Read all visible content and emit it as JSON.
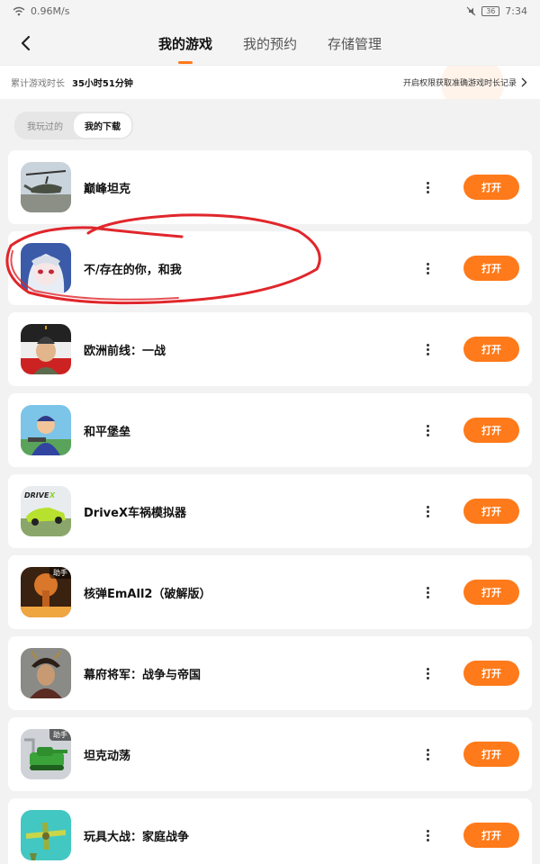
{
  "status": {
    "speed": "0.96M/s",
    "battery": "36",
    "time": "7:34"
  },
  "nav": {
    "tabs": [
      {
        "label": "我的游戏",
        "active": true
      },
      {
        "label": "我的预约",
        "active": false
      },
      {
        "label": "存储管理",
        "active": false
      }
    ]
  },
  "playtime": {
    "label": "累计游戏时长",
    "value": "35小时51分钟",
    "link": "开启权限获取准确游戏时长记录"
  },
  "filters": {
    "played": "我玩过的",
    "downloaded": "我的下载"
  },
  "open_label": "打开",
  "games": [
    {
      "name": "巅峰坦克",
      "icon": "helicopter-icon"
    },
    {
      "name": "不/存在的你，和我",
      "icon": "anime-girl-icon"
    },
    {
      "name": "欧洲前线：一战",
      "icon": "general-icon"
    },
    {
      "name": "和平堡垒",
      "icon": "soldier-icon"
    },
    {
      "name": "DriveX车祸模拟器",
      "icon": "car-icon"
    },
    {
      "name": "核弹EmAll2（破解版）",
      "icon": "nuke-icon",
      "badge": "助手"
    },
    {
      "name": "幕府将军：战争与帝国",
      "icon": "samurai-icon"
    },
    {
      "name": "坦克动荡",
      "icon": "tank-icon",
      "badge": "助手"
    },
    {
      "name": "玩具大战：家庭战争",
      "icon": "plane-icon"
    }
  ],
  "colors": {
    "accent": "#ff7a1a",
    "annotation": "#e0262b"
  }
}
